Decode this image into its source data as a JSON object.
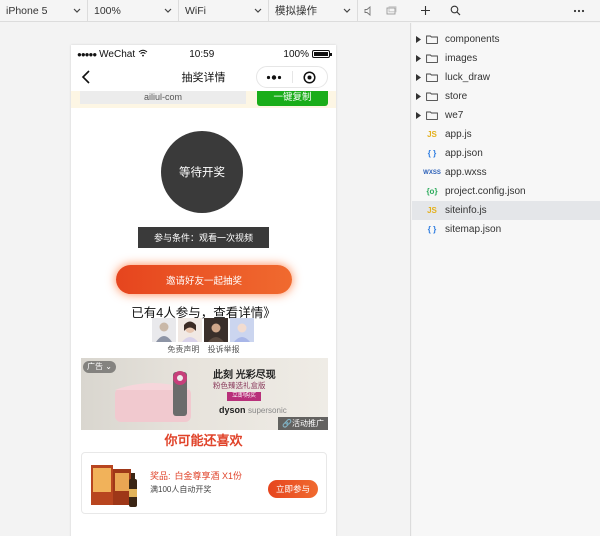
{
  "toolbar": {
    "device": "iPhone 5",
    "zoom": "100%",
    "network": "WiFi",
    "operation": "模拟操作"
  },
  "status_bar": {
    "carrier": "WeChat",
    "time": "10:59",
    "battery": "100%",
    "battery_level": 1.0
  },
  "nav": {
    "title": "抽奖详情"
  },
  "copy_bar": {
    "url": "ailiul-com",
    "button": "一键复制"
  },
  "lottery": {
    "status": "等待开奖",
    "condition": "参与条件：观看一次视频",
    "invite_button": "邀请好友一起抽奖",
    "participants_text": "已有4人参与，查看详情》",
    "disclaimer": "免责声明",
    "report": "投诉举报"
  },
  "ad": {
    "tag": "广告",
    "title": "此刻 光彩尽现",
    "subtitle": "粉色臻选礼盒版",
    "cta": "立即购买",
    "brand": "dyson",
    "brand_sub": "supersonic",
    "promo": "活动推广"
  },
  "recommend": {
    "title": "你可能还喜欢",
    "prize_label": "奖品:",
    "prize_name": "白金尊享酒 X1份",
    "prize_desc": "满100人自动开奖",
    "join_button": "立即参与"
  },
  "explorer": {
    "items": [
      {
        "name": "components",
        "type": "folder"
      },
      {
        "name": "images",
        "type": "folder"
      },
      {
        "name": "luck_draw",
        "type": "folder"
      },
      {
        "name": "store",
        "type": "folder"
      },
      {
        "name": "we7",
        "type": "folder"
      },
      {
        "name": "app.js",
        "type": "js"
      },
      {
        "name": "app.json",
        "type": "json"
      },
      {
        "name": "app.wxss",
        "type": "wxss"
      },
      {
        "name": "project.config.json",
        "type": "config"
      },
      {
        "name": "siteinfo.js",
        "type": "js",
        "selected": true
      },
      {
        "name": "sitemap.json",
        "type": "json"
      }
    ]
  },
  "colors": {
    "accent_orange": "#e6451e",
    "copy_green": "#1aad19",
    "title_red": "#e0432a",
    "dark_gray": "#3a3a3a"
  }
}
